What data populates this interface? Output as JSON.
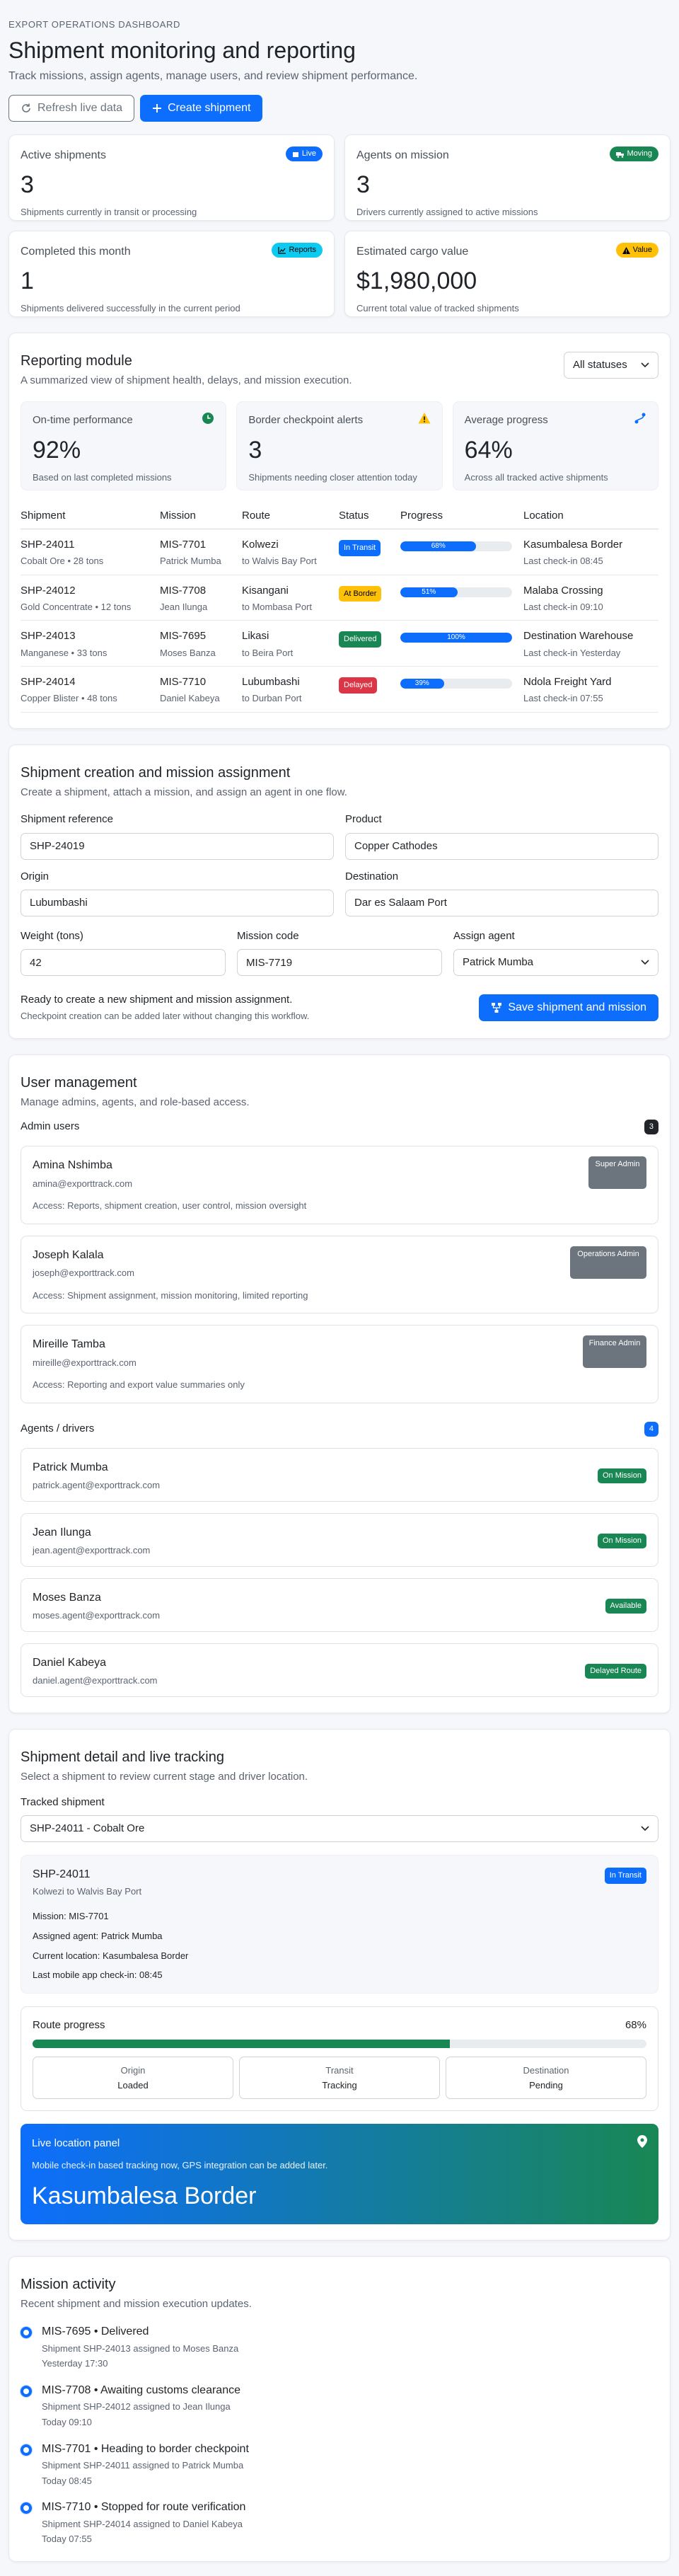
{
  "header": {
    "eyebrow": "EXPORT OPERATIONS DASHBOARD",
    "title": "Shipment monitoring and reporting",
    "subtitle": "Track missions, assign agents, manage users, and review shipment performance.",
    "refresh_label": "Refresh live data",
    "create_label": "Create shipment"
  },
  "kpis": [
    {
      "label": "Active shipments",
      "badge": "Live",
      "value": "3",
      "desc": "Shipments currently in transit or processing",
      "badge_color": "#0d6efd",
      "icon": "box-icon"
    },
    {
      "label": "Agents on mission",
      "badge": "Moving",
      "value": "3",
      "desc": "Drivers currently assigned to active missions",
      "badge_color": "#198754",
      "icon": "truck-icon"
    },
    {
      "label": "Completed this month",
      "badge": "Reports",
      "value": "1",
      "desc": "Shipments delivered successfully in the current period",
      "badge_color": "#0dcaf0",
      "icon": "chart-icon"
    },
    {
      "label": "Estimated cargo value",
      "badge": "Value",
      "value": "$1,980,000",
      "desc": "Current total value of tracked shipments",
      "badge_color": "#ffc107",
      "icon": "warning-icon"
    }
  ],
  "reporting": {
    "title": "Reporting module",
    "desc": "A summarized view of shipment health, delays, and mission execution.",
    "filter": "All statuses",
    "cards": [
      {
        "label": "On-time performance",
        "value": "92%",
        "desc": "Based on last completed missions",
        "icon": "clock-icon"
      },
      {
        "label": "Border checkpoint alerts",
        "value": "3",
        "desc": "Shipments needing closer attention today",
        "icon": "warning-icon"
      },
      {
        "label": "Average progress",
        "value": "64%",
        "desc": "Across all tracked active shipments",
        "icon": "route-icon"
      }
    ],
    "columns": [
      "Shipment",
      "Mission",
      "Route",
      "Status",
      "Progress",
      "Location"
    ],
    "rows": [
      {
        "id": "SHP-24011",
        "cargo": "Cobalt Ore • 28 tons",
        "mission": "MIS-7701",
        "agent": "Patrick Mumba",
        "route_to": "Kolwezi",
        "route_from": "to Walvis Bay Port",
        "status": "In Transit",
        "progress": 68,
        "progress_label": "68%",
        "location": "Kasumbalesa Border",
        "checkin": "Last check-in 08:45"
      },
      {
        "id": "SHP-24012",
        "cargo": "Gold Concentrate • 12 tons",
        "mission": "MIS-7708",
        "agent": "Jean Ilunga",
        "route_to": "Kisangani",
        "route_from": "to Mombasa Port",
        "status": "At Border",
        "progress": 51,
        "progress_label": "51%",
        "location": "Malaba Crossing",
        "checkin": "Last check-in 09:10"
      },
      {
        "id": "SHP-24013",
        "cargo": "Manganese • 33 tons",
        "mission": "MIS-7695",
        "agent": "Moses Banza",
        "route_to": "Likasi",
        "route_from": "to Beira Port",
        "status": "Delivered",
        "progress": 100,
        "progress_label": "100%",
        "location": "Destination Warehouse",
        "checkin": "Last check-in Yesterday"
      },
      {
        "id": "SHP-24014",
        "cargo": "Copper Blister • 48 tons",
        "mission": "MIS-7710",
        "agent": "Daniel Kabeya",
        "route_to": "Lubumbashi",
        "route_from": "to Durban Port",
        "status": "Delayed",
        "progress": 39,
        "progress_label": "39%",
        "location": "Ndola Freight Yard",
        "checkin": "Last check-in 07:55"
      }
    ]
  },
  "creation": {
    "title": "Shipment creation and mission assignment",
    "desc": "Create a shipment, attach a mission, and assign an agent in one flow.",
    "ref_label": "Shipment reference",
    "ref_value": "SHP-24019",
    "product_label": "Product",
    "product_value": "Copper Cathodes",
    "origin_label": "Origin",
    "origin_value": "Lubumbashi",
    "dest_label": "Destination",
    "dest_value": "Dar es Salaam Port",
    "weight_label": "Weight (tons)",
    "weight_value": "42",
    "mission_label": "Mission code",
    "mission_value": "MIS-7719",
    "agent_label": "Assign agent",
    "agent_value": "Patrick Mumba",
    "ready_text": "Ready to create a new shipment and mission assignment.",
    "ready_sub": "Checkpoint creation can be added later without changing this workflow.",
    "save_label": "Save shipment and mission"
  },
  "users": {
    "title": "User management",
    "desc": "Manage admins, agents, and role-based access.",
    "admins_label": "Admin users",
    "admins_count": "3",
    "admins": [
      {
        "name": "Amina Nshimba",
        "email": "amina@exporttrack.com",
        "access": "Access: Reports, shipment creation, user control, mission oversight",
        "role": "Super Admin"
      },
      {
        "name": "Joseph Kalala",
        "email": "joseph@exporttrack.com",
        "access": "Access: Shipment assignment, mission monitoring, limited reporting",
        "role": "Operations Admin"
      },
      {
        "name": "Mireille Tamba",
        "email": "mireille@exporttrack.com",
        "access": "Access: Reporting and export value summaries only",
        "role": "Finance Admin"
      }
    ],
    "agents_label": "Agents / drivers",
    "agents_count": "4",
    "agents": [
      {
        "name": "Patrick Mumba",
        "email": "patrick.agent@exporttrack.com",
        "status": "On Mission"
      },
      {
        "name": "Jean Ilunga",
        "email": "jean.agent@exporttrack.com",
        "status": "On Mission"
      },
      {
        "name": "Moses Banza",
        "email": "moses.agent@exporttrack.com",
        "status": "Available"
      },
      {
        "name": "Daniel Kabeya",
        "email": "daniel.agent@exporttrack.com",
        "status": "Delayed Route"
      }
    ]
  },
  "detail": {
    "title": "Shipment detail and live tracking",
    "desc": "Select a shipment to review current stage and driver location.",
    "tracked_label": "Tracked shipment",
    "tracked_value": "SHP-24011 - Cobalt Ore",
    "ship_id": "SHP-24011",
    "route": "Kolwezi to Walvis Bay Port",
    "status": "In Transit",
    "mission": "Mission: MIS-7701",
    "agent": "Assigned agent: Patrick Mumba",
    "location": "Current location: Kasumbalesa Border",
    "checkin": "Last mobile app check-in: 08:45",
    "route_label": "Route progress",
    "route_pct_label": "68%",
    "route_pct": 68,
    "stages": [
      {
        "label": "Origin",
        "value": "Loaded"
      },
      {
        "label": "Transit",
        "value": "Tracking"
      },
      {
        "label": "Destination",
        "value": "Pending"
      }
    ],
    "live_title": "Live location panel",
    "live_desc": "Mobile check-in based tracking now, GPS integration can be added later.",
    "live_location": "Kasumbalesa Border"
  },
  "activity": {
    "title": "Mission activity",
    "desc": "Recent shipment and mission execution updates.",
    "items": [
      {
        "title": "MIS-7695 • Delivered",
        "sub": "Shipment SHP-24013 assigned to Moses Banza",
        "time": "Yesterday 17:30"
      },
      {
        "title": "MIS-7708 • Awaiting customs clearance",
        "sub": "Shipment SHP-24012 assigned to Jean Ilunga",
        "time": "Today 09:10"
      },
      {
        "title": "MIS-7701 • Heading to border checkpoint",
        "sub": "Shipment SHP-24011 assigned to Patrick Mumba",
        "time": "Today 08:45"
      },
      {
        "title": "MIS-7710 • Stopped for route verification",
        "sub": "Shipment SHP-24014 assigned to Daniel Kabeya",
        "time": "Today 07:55"
      }
    ]
  },
  "colors": {
    "primary": "#0d6efd",
    "success": "#198754",
    "warning": "#ffc107",
    "danger": "#dc3545",
    "info": "#0dcaf0"
  }
}
